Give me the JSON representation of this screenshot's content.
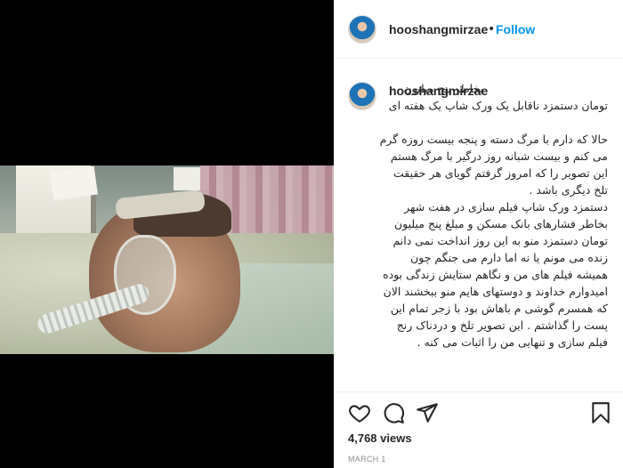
{
  "post": {
    "username": "hooshangmirzae",
    "dot": "•",
    "follow_label": "Follow",
    "views": "4,768 views",
    "date": "MARCH 1"
  },
  "caption": {
    "title_line": "بخاطر پنج میلیون تومان دستمزد ناقابل یک ورک شاپ یک هفته ای",
    "paragraph_1": "حالا که دارم با مرگ دسته و پنجه بیست روزه گرم می کنم و بیست شبانه روز درگیر با مرگ هستم این تصویر را که امروز گرفتم گویای هر حقیقت تلخ دیگری باشد .",
    "paragraph_2": "دستمزد ورک شاپ فیلم سازی در هفت شهر بخاطر فشارهای بانک مسکن و مبلغ پنج میلیون تومان دستمزد منو به این روز انداخت نمی دانم زنده می مونم یا نه اما دارم می جنگم چون همیشه فیلم های من و نگاهم ستایش زندگی بوده امیدوارم خداوند و دوستهای هایم منو ببخشند الان که همسرم گوشی م باهاش بود با زجر تمام این پست را گذاشتم . این تصویر تلخ و دردناک رنج فیلم سازی و تنهایی من را اثبات می کنه ."
  },
  "icons": {
    "heart": "heart-icon",
    "comment": "comment-icon",
    "share": "share-icon",
    "save": "bookmark-icon",
    "avatar": "avatar"
  },
  "colors": {
    "follow": "#0095f6",
    "text": "#262626",
    "muted": "#8e8e8e"
  }
}
